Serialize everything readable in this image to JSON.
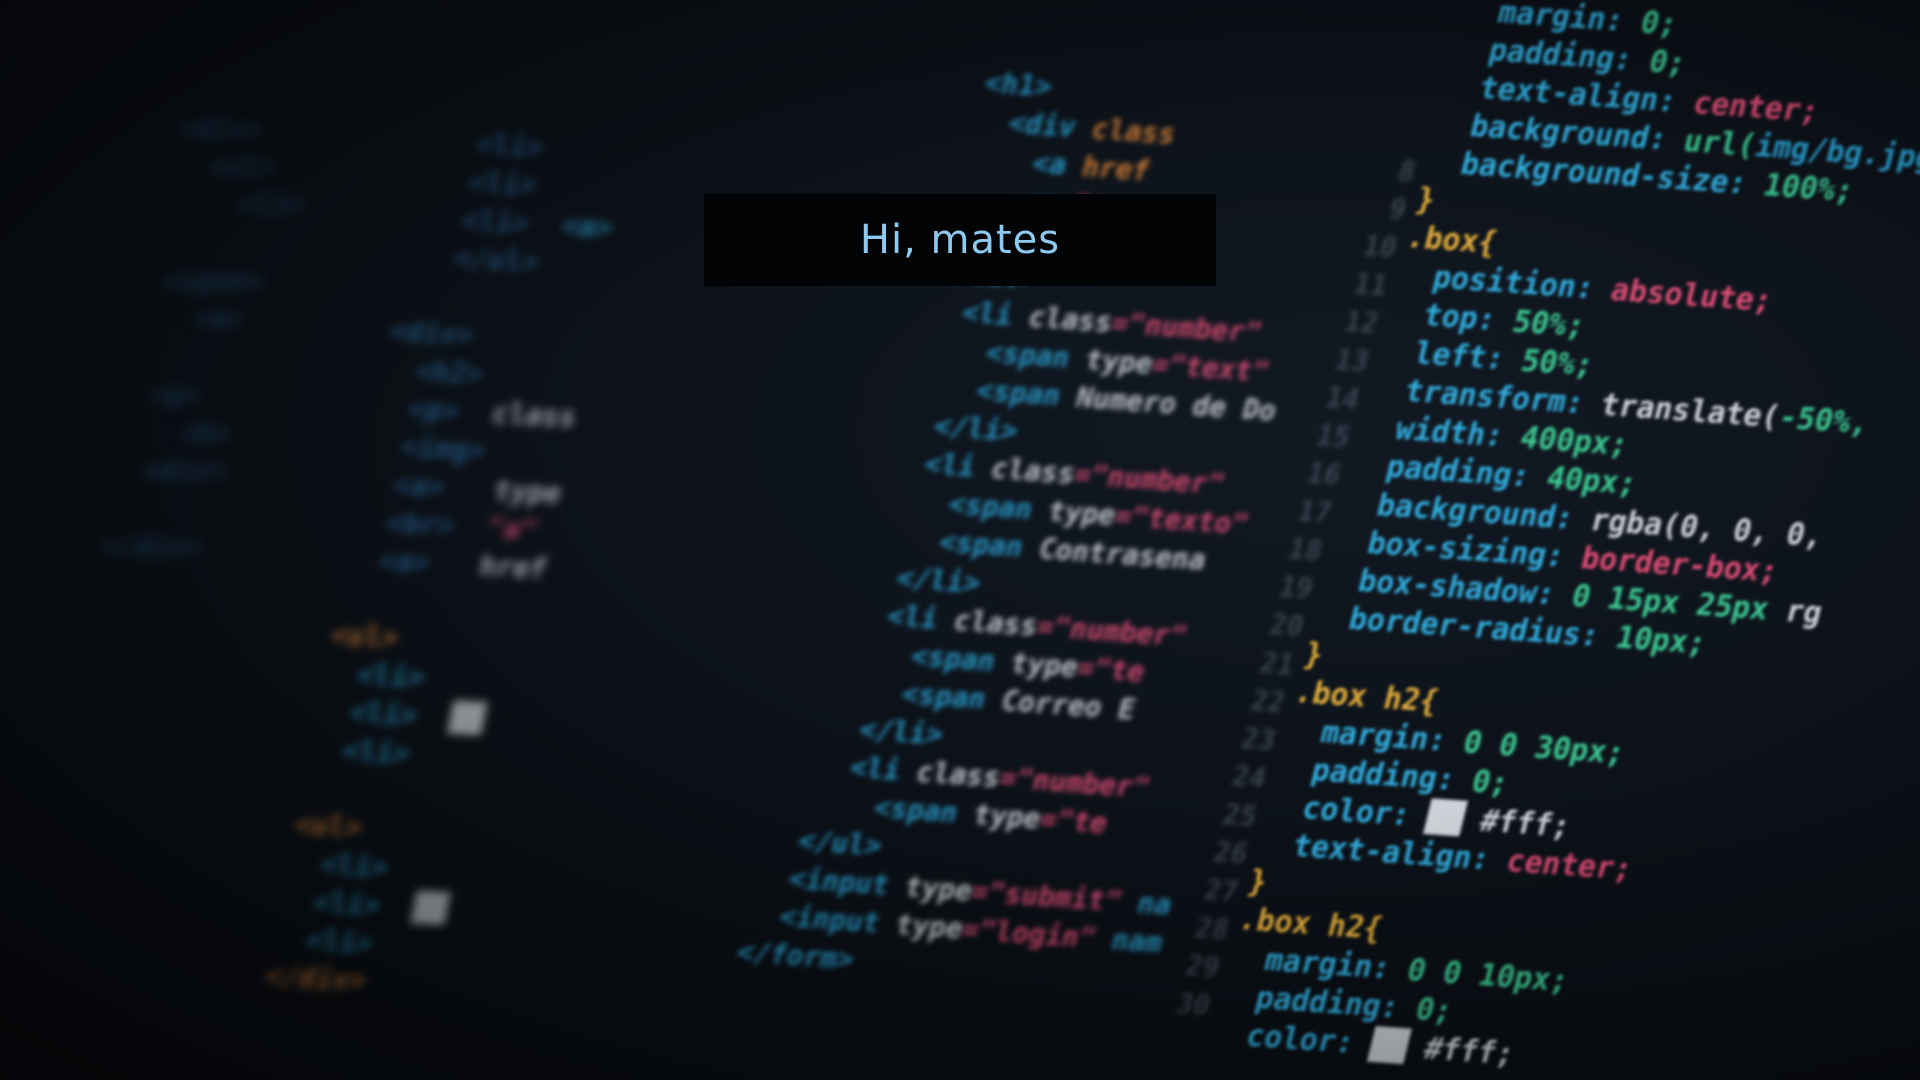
{
  "caption": {
    "text": "Hi, mates"
  },
  "colors": {
    "caption_background": "#020304",
    "caption_text": "#8ec9ef",
    "background": "#0b0e13"
  }
}
